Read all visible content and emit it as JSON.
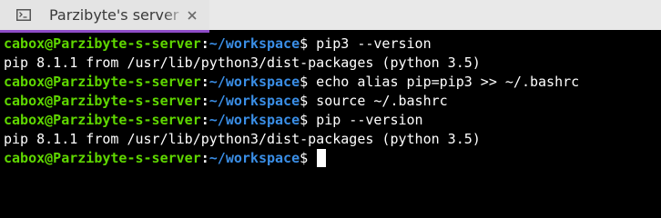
{
  "tab": {
    "title": "Parzibyte's server",
    "icon": "terminal-icon",
    "close_icon": "close-icon",
    "accent_color": "#8e4bc8"
  },
  "colors": {
    "background": "#000000",
    "user_host": "#5fd700",
    "path": "#3a8ee6",
    "text": "#ffffff"
  },
  "prompt": {
    "user_host": "cabox@Parzibyte-s-server",
    "separator": ":",
    "path": "~/workspace",
    "symbol": "$"
  },
  "lines": [
    {
      "type": "command",
      "text": "pip3 --version"
    },
    {
      "type": "output",
      "text": "pip 8.1.1 from /usr/lib/python3/dist-packages (python 3.5)"
    },
    {
      "type": "command",
      "text": "echo alias pip=pip3 >> ~/.bashrc"
    },
    {
      "type": "command",
      "text": "source ~/.bashrc"
    },
    {
      "type": "command",
      "text": "pip --version"
    },
    {
      "type": "output",
      "text": "pip 8.1.1 from /usr/lib/python3/dist-packages (python 3.5)"
    },
    {
      "type": "command",
      "text": ""
    }
  ]
}
